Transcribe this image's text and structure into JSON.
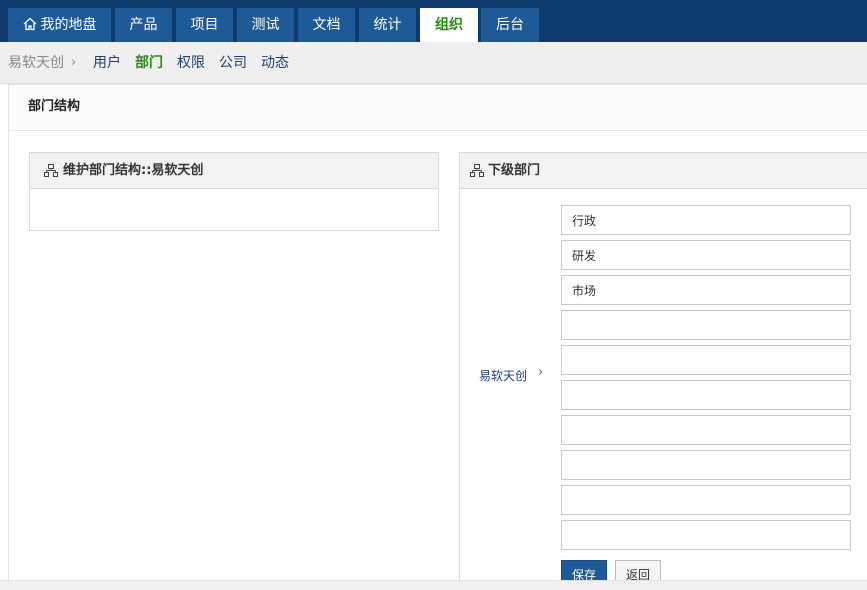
{
  "topnav": {
    "tabs": [
      {
        "label": "我的地盘",
        "icon": "home-icon",
        "active": false
      },
      {
        "label": "产品",
        "active": false
      },
      {
        "label": "项目",
        "active": false
      },
      {
        "label": "测试",
        "active": false
      },
      {
        "label": "文档",
        "active": false
      },
      {
        "label": "统计",
        "active": false
      },
      {
        "label": "组织",
        "active": true
      },
      {
        "label": "后台",
        "active": false
      }
    ]
  },
  "subnav": {
    "company": "易软天创",
    "separator": "›",
    "links": [
      {
        "label": "用户",
        "active": false
      },
      {
        "label": "部门",
        "active": true
      },
      {
        "label": "权限",
        "active": false
      },
      {
        "label": "公司",
        "active": false
      },
      {
        "label": "动态",
        "active": false
      }
    ]
  },
  "main": {
    "title": "部门结构",
    "left_box": {
      "icon": "org-chart-icon",
      "title": "维护部门结构::易软天创"
    },
    "right_box": {
      "icon": "org-chart-icon",
      "title": "下级部门",
      "parent_link": "易软天创",
      "parent_arrow": "›",
      "departments": [
        "行政",
        "研发",
        "市场",
        "",
        "",
        "",
        "",
        "",
        "",
        ""
      ],
      "save_label": "保存",
      "back_label": "返回"
    }
  },
  "colors": {
    "nav_bg": "#0e3a6e",
    "tab_bg": "#1f5a98",
    "active_text": "#2b8a12",
    "link": "#1d3f73"
  }
}
